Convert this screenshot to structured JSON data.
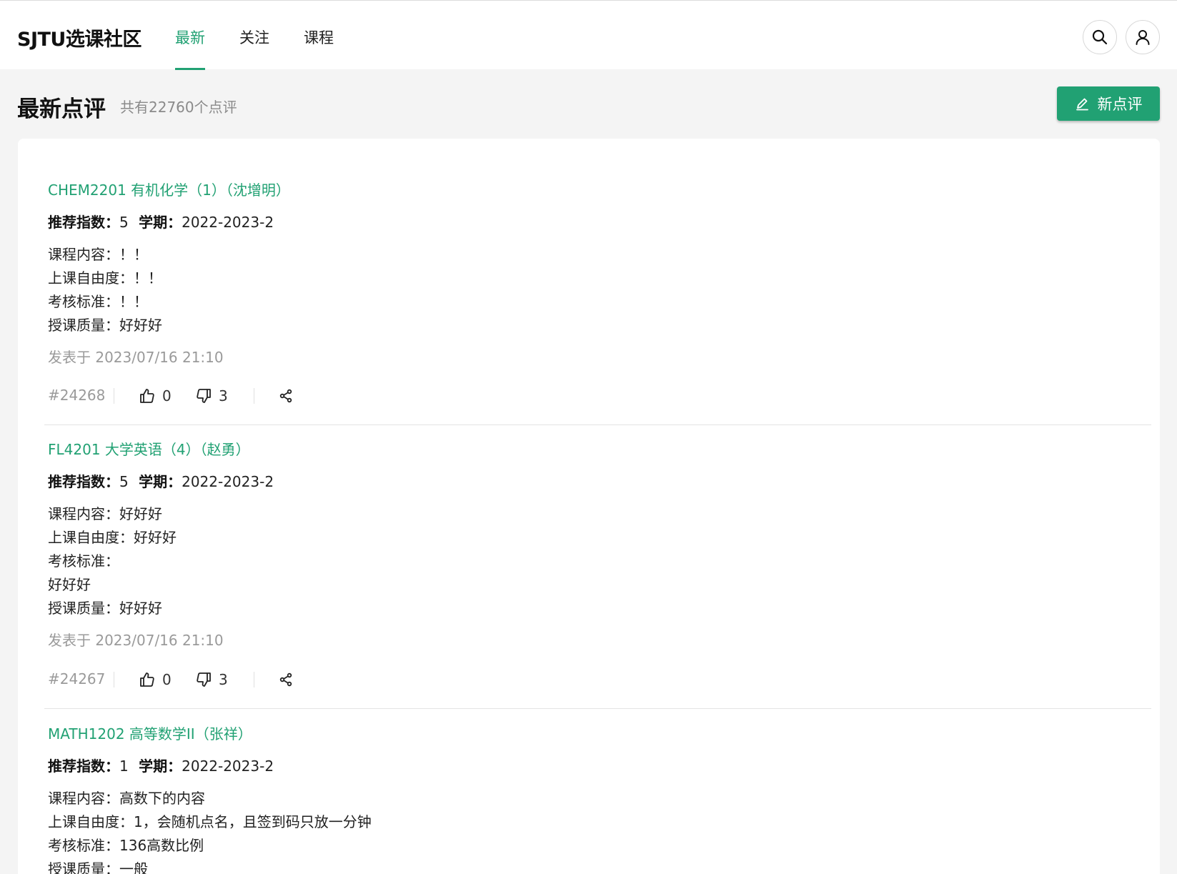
{
  "header": {
    "brand": "SJTU选课社区",
    "tabs": [
      {
        "label": "最新",
        "active": true
      },
      {
        "label": "关注",
        "active": false
      },
      {
        "label": "课程",
        "active": false
      }
    ],
    "search_icon": "search-icon",
    "user_icon": "user-icon"
  },
  "page": {
    "title": "最新点评",
    "count_text": "共有22760个点评",
    "new_review_label": "新点评",
    "new_review_icon": "pencil-icon"
  },
  "labels": {
    "score": "推荐指数：",
    "semester": "学期："
  },
  "reviews": [
    {
      "course": "CHEM2201 有机化学（1）（沈增明）",
      "score": "5",
      "semester": "2022-2023-2",
      "content": [
        "课程内容：！！",
        "上课自由度：！！",
        "考核标准：！！",
        "授课质量：好好好"
      ],
      "posted": "发表于 2023/07/16 21:10",
      "id": "#24268",
      "likes": "0",
      "dislikes": "3"
    },
    {
      "course": "FL4201 大学英语（4）（赵勇）",
      "score": "5",
      "semester": "2022-2023-2",
      "content": [
        "课程内容：好好好",
        "上课自由度：好好好",
        "考核标准：",
        "好好好",
        "授课质量：好好好"
      ],
      "posted": "发表于 2023/07/16 21:10",
      "id": "#24267",
      "likes": "0",
      "dislikes": "3"
    },
    {
      "course": "MATH1202 高等数学II（张祥）",
      "score": "1",
      "semester": "2022-2023-2",
      "content": [
        "课程内容：高数下的内容",
        "上课自由度：1，会随机点名，且签到码只放一分钟",
        "考核标准：136高数比例",
        "授课质量：一般"
      ]
    }
  ],
  "colors": {
    "accent": "#21a173",
    "muted": "#9a9a9a",
    "background": "#f4f4f4"
  }
}
